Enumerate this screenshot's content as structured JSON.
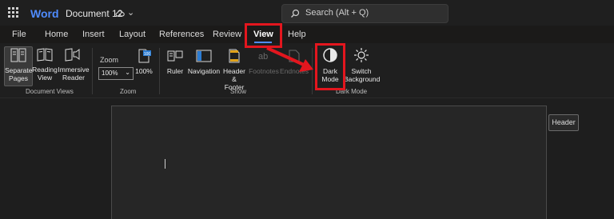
{
  "titlebar": {
    "app_name": "Word",
    "document_name": "Document 12",
    "search_placeholder": "Search (Alt + Q)",
    "icons": [
      "app-launcher-icon",
      "cloud-sync-icon",
      "chevron-down-icon",
      "search-icon"
    ]
  },
  "tabs": [
    {
      "label": "File"
    },
    {
      "label": "Home"
    },
    {
      "label": "Insert"
    },
    {
      "label": "Layout"
    },
    {
      "label": "References"
    },
    {
      "label": "Review"
    },
    {
      "label": "View",
      "active": true
    },
    {
      "label": "Help"
    }
  ],
  "ribbon": {
    "document_views": {
      "group_label": "Document Views",
      "buttons": [
        {
          "line1": "Separate",
          "line2": "Pages",
          "selected": true
        },
        {
          "line1": "Reading",
          "line2": "View"
        },
        {
          "line1": "Immersive",
          "line2": "Reader"
        }
      ]
    },
    "zoom": {
      "group_label": "Zoom",
      "zoom_label": "Zoom",
      "zoom_value": "100%",
      "button_label": "100%",
      "icon_badge": "100"
    },
    "show": {
      "group_label": "Show",
      "buttons": [
        {
          "line1": "Ruler",
          "line2": ""
        },
        {
          "line1": "Navigation",
          "line2": ""
        },
        {
          "line1": "Header &",
          "line2": "Footer"
        },
        {
          "line1": "Footnotes",
          "line2": "",
          "disabled": true
        },
        {
          "line1": "Endnotes",
          "line2": "",
          "disabled": true
        }
      ]
    },
    "dark_mode": {
      "group_label": "Dark Mode",
      "buttons": [
        {
          "line1": "Dark",
          "line2": "Mode"
        },
        {
          "line1": "Switch",
          "line2": "Background"
        }
      ]
    }
  },
  "document": {
    "header_tag": "Header"
  },
  "colors": {
    "accent_blue": "#4f8cff",
    "annotation_red": "#e3161e",
    "background": "#1b1a19"
  }
}
